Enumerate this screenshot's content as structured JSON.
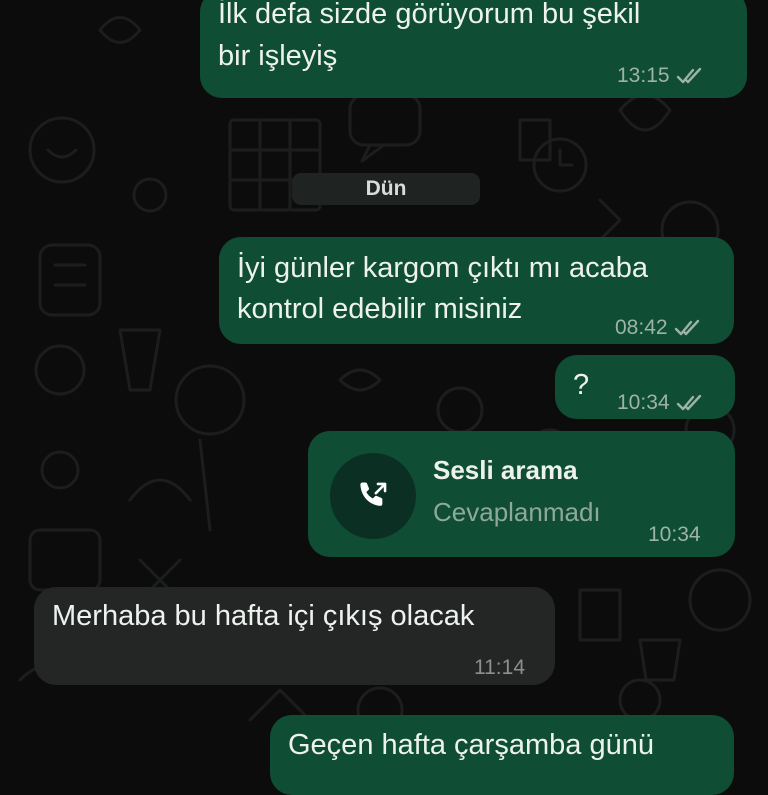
{
  "colors": {
    "outgoing_bubble": "#0f4d35",
    "incoming_bubble": "#242626",
    "background": "#0b0c0b",
    "read_ticks": "#9db3a8"
  },
  "messages": [
    {
      "direction": "outgoing",
      "text_line1": "İlk defa sizde görüyorum bu şekil",
      "text_line2": "bir işleyiş",
      "time": "13:15",
      "status": "read"
    },
    {
      "direction": "outgoing",
      "text_line1": "İyi günler kargom çıktı mı acaba",
      "text_line2": "kontrol edebilir misiniz",
      "time": "08:42",
      "status": "read"
    },
    {
      "direction": "outgoing",
      "text": "?",
      "time": "10:34",
      "status": "read"
    },
    {
      "direction": "outgoing",
      "type": "call",
      "call_title": "Sesli arama",
      "call_status": "Cevaplanmadı",
      "time": "10:34",
      "icon": "phone-outgoing-icon"
    },
    {
      "direction": "incoming",
      "text": "Merhaba bu hafta içi çıkış olacak",
      "time": "11:14"
    },
    {
      "direction": "outgoing",
      "text": "Geçen hafta çarşamba günü"
    }
  ],
  "date_separator": "Dün"
}
